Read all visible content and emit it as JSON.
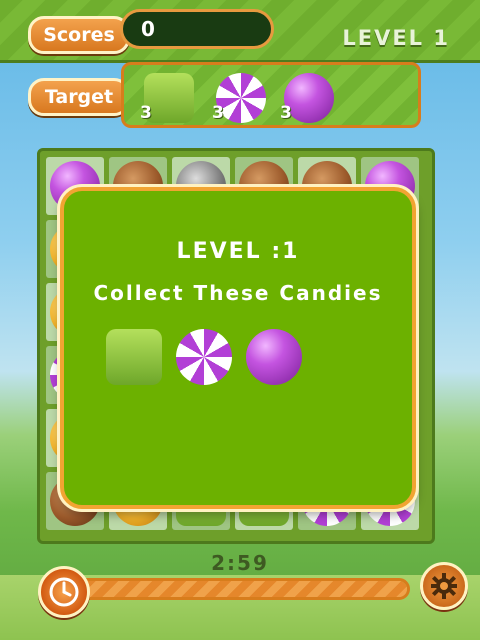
{
  "header": {
    "scores_label": "Scores",
    "score_value": "0",
    "level_label": "LEVEL 1"
  },
  "target": {
    "label": "Target",
    "items": [
      {
        "candy": "green-square-candy",
        "count": "3"
      },
      {
        "candy": "purple-swirl-candy",
        "count": "3"
      },
      {
        "candy": "purple-round-candy",
        "count": "3"
      }
    ]
  },
  "modal": {
    "level_text": "LEVEL :1",
    "message": "Collect These Candies",
    "candies": [
      "green-square-candy",
      "purple-swirl-candy",
      "purple-round-candy"
    ]
  },
  "timer": {
    "time": "2:59",
    "progress_fraction": 1.0
  },
  "colors": {
    "accent_orange": "#e79a3f",
    "board_green": "#6cb100",
    "candy_purple": "#b23fd6"
  }
}
